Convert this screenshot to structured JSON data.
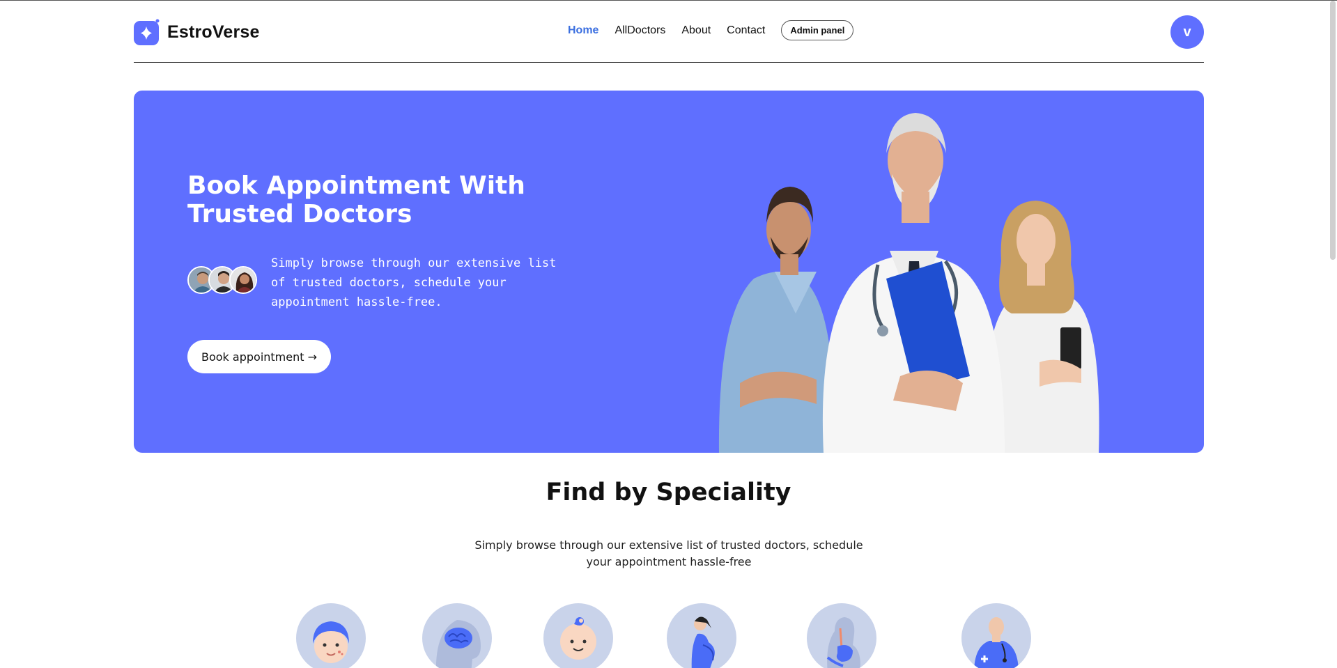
{
  "navbar": {
    "brand": "EstroVerse",
    "links": [
      {
        "label": "Home",
        "active": true
      },
      {
        "label": "AllDoctors",
        "active": false
      },
      {
        "label": "About",
        "active": false
      },
      {
        "label": "Contact",
        "active": false
      }
    ],
    "admin_button": "Admin panel",
    "avatar_letter": "v"
  },
  "hero": {
    "title": "Book Appointment With Trusted Doctors",
    "description": "Simply browse through our extensive list of trusted doctors, schedule your appointment hassle-free.",
    "button": "Book appointment →"
  },
  "speciality": {
    "title": "Find by Speciality",
    "description": "Simply browse through our extensive list of trusted doctors, schedule your appointment hassle-free",
    "icons": [
      "dermatologist-icon",
      "neurologist-icon",
      "pediatrician-icon",
      "gynecologist-icon",
      "gastroenterologist-icon",
      "general-physician-icon"
    ]
  },
  "colors": {
    "primary": "#5f6fff",
    "active_link": "#3b6fe0",
    "speciality_bg": "#c9d3ea"
  }
}
